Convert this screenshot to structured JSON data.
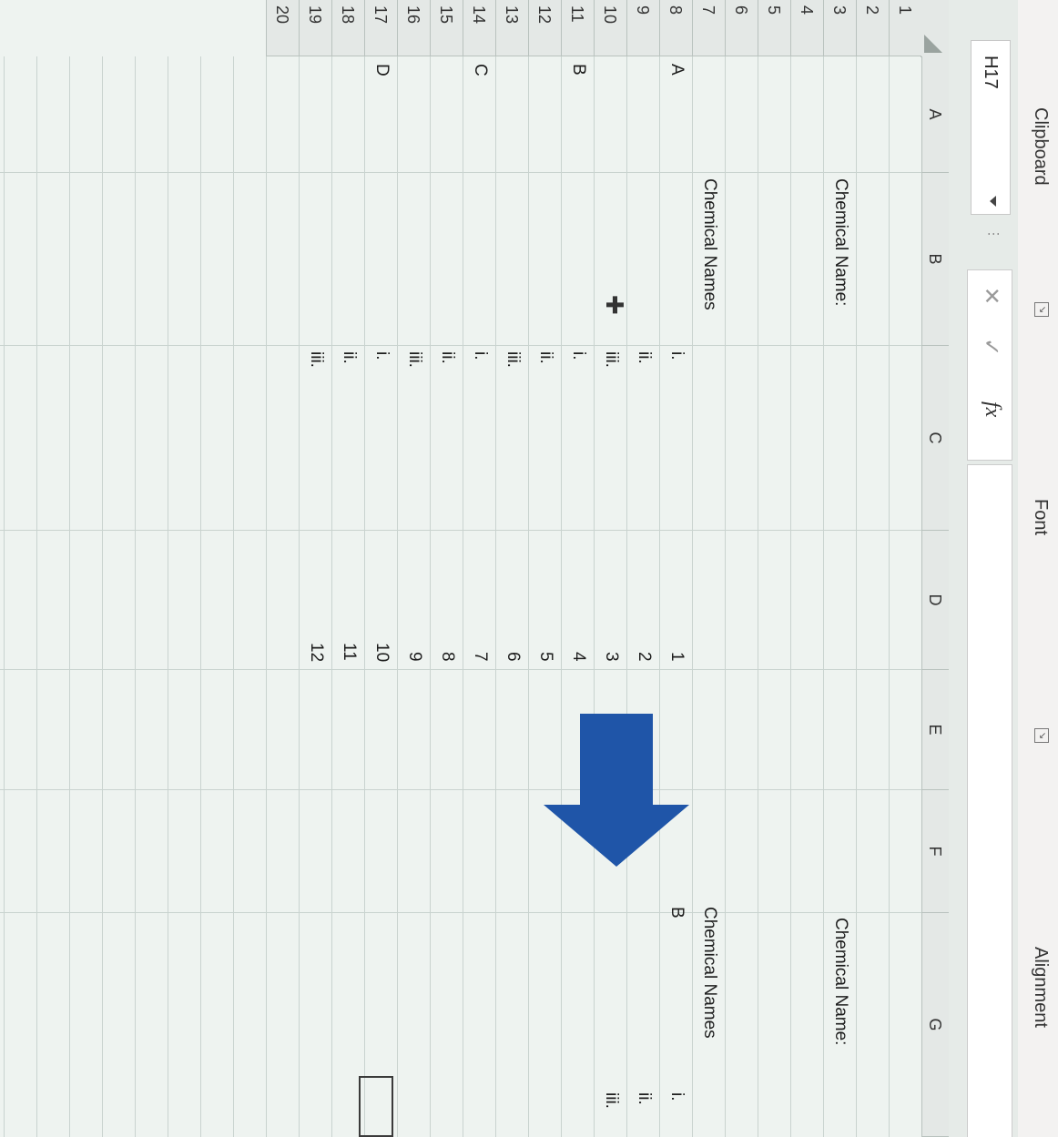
{
  "ribbon": {
    "groups": [
      "Clipboard",
      "Font",
      "Alignment"
    ]
  },
  "formula_bar": {
    "name_box": "H17",
    "cancel_icon": "close-icon",
    "enter_icon": "check-icon",
    "fx_label": "fx",
    "formula": ""
  },
  "sheet": {
    "columns": [
      "A",
      "B",
      "C",
      "D",
      "E",
      "F",
      "G"
    ],
    "rows": [
      "1",
      "2",
      "3",
      "4",
      "5",
      "6",
      "7",
      "8",
      "9",
      "10",
      "11",
      "12",
      "13",
      "14",
      "15",
      "16",
      "17",
      "18",
      "19",
      "20"
    ],
    "cells": {
      "B3": "Chemical Name:",
      "B7": "Chemical Names",
      "A8": "A",
      "C8": "i.",
      "D8": "1",
      "C9": "ii.",
      "D9": "2",
      "C10": "iii.",
      "D10": "3",
      "A11": "B",
      "C11": "i.",
      "D11": "4",
      "C12": "ii.",
      "D12": "5",
      "C13": "iii.",
      "D13": "6",
      "A14": "C",
      "C14": "i.",
      "D14": "7",
      "C15": "ii.",
      "D15": "8",
      "C16": "iii.",
      "D16": "9",
      "A17": "D",
      "C17": "i.",
      "D17": "10",
      "C18": "ii.",
      "D18": "11",
      "C19": "iii.",
      "D19": "12",
      "G3": "Chemical Name:",
      "G7": "Chemical Names",
      "G8": "B",
      "H8": "i.",
      "H9": "ii.",
      "H10": "iii."
    },
    "selected_cell": "H17",
    "arrow_color": "#1f55a8"
  }
}
